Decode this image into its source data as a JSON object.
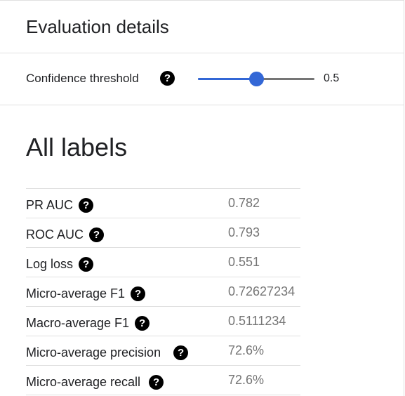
{
  "header": {
    "title": "Evaluation details"
  },
  "threshold": {
    "label": "Confidence threshold",
    "value": "0.5",
    "fraction": 0.5,
    "help_icon": "help-icon"
  },
  "section": {
    "title": "All labels"
  },
  "metrics": [
    {
      "label": "PR AUC",
      "value": "0.782"
    },
    {
      "label": "ROC AUC",
      "value": "0.793"
    },
    {
      "label": "Log loss",
      "value": "0.551"
    },
    {
      "label": "Micro-average F1",
      "value": "0.72627234"
    },
    {
      "label": "Macro-average F1",
      "value": "0.5111234"
    },
    {
      "label": "Micro-average precision",
      "value": "72.6%"
    },
    {
      "label": "Micro-average recall",
      "value": "72.6%"
    }
  ],
  "colors": {
    "accent": "#3367d6",
    "track": "#757575",
    "divider": "#e0e0e0",
    "value_text": "#757575"
  },
  "help_glyph": "?"
}
